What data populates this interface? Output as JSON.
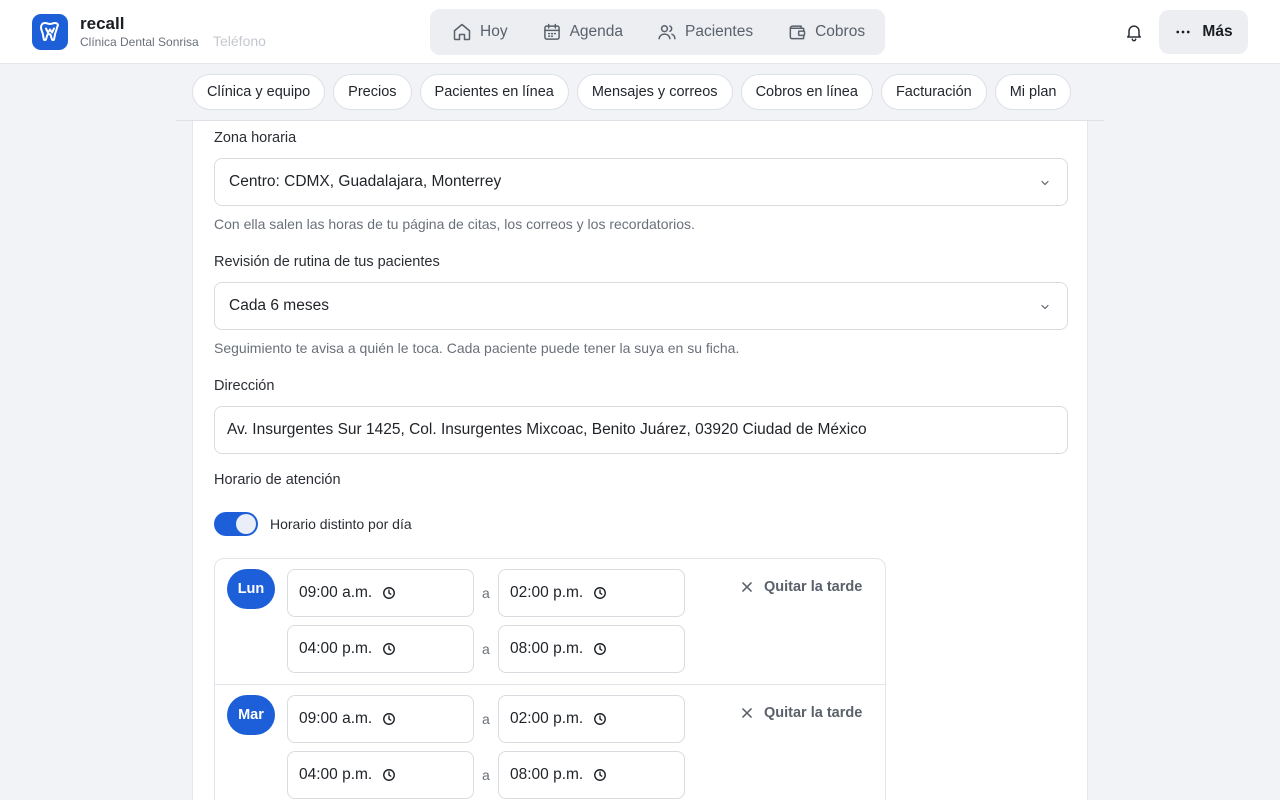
{
  "brand": {
    "name": "recall",
    "subtitle": "Clínica Dental Sonrisa",
    "ghost_label": "Teléfono"
  },
  "nav": [
    {
      "label": "Hoy",
      "icon": "home-icon"
    },
    {
      "label": "Agenda",
      "icon": "calendar-icon"
    },
    {
      "label": "Pacientes",
      "icon": "users-icon"
    },
    {
      "label": "Cobros",
      "icon": "wallet-icon"
    }
  ],
  "header": {
    "more_label": "Más"
  },
  "tabs": [
    "Clínica y equipo",
    "Precios",
    "Pacientes en línea",
    "Mensajes y correos",
    "Cobros en línea",
    "Facturación",
    "Mi plan"
  ],
  "form": {
    "timezone": {
      "label": "Zona horaria",
      "value": "Centro: CDMX, Guadalajara, Monterrey",
      "help": "Con ella salen las horas de tu página de citas, los correos y los recordatorios."
    },
    "recall": {
      "label": "Revisión de rutina de tus pacientes",
      "value": "Cada 6 meses",
      "help": "Seguimiento te avisa a quién le toca. Cada paciente puede tener la suya en su ficha."
    },
    "address": {
      "label": "Dirección",
      "value": "Av. Insurgentes Sur 1425, Col. Insurgentes Mixcoac, Benito Juárez, 03920 Ciudad de México"
    },
    "hours": {
      "label": "Horario de atención",
      "toggle_label": "Horario distinto por día",
      "toggle_on": true,
      "separator": "a",
      "remove_label": "Quitar la tarde",
      "days": [
        {
          "day": "Lun",
          "morning_start": "09:00 a.m.",
          "morning_end": "02:00 p.m.",
          "afternoon_start": "04:00 p.m.",
          "afternoon_end": "08:00 p.m."
        },
        {
          "day": "Mar",
          "morning_start": "09:00 a.m.",
          "morning_end": "02:00 p.m.",
          "afternoon_start": "04:00 p.m.",
          "afternoon_end": "08:00 p.m."
        }
      ]
    }
  },
  "colors": {
    "accent": "#1c5fd9",
    "background": "#f1f3f6"
  }
}
